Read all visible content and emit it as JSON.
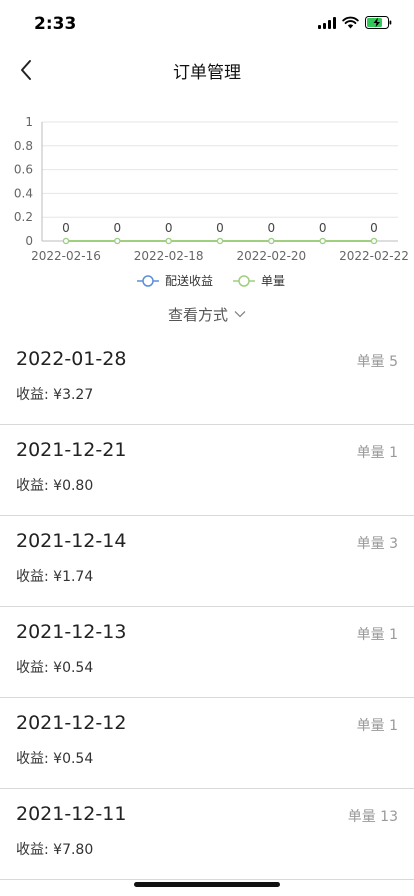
{
  "status": {
    "time": "2:33"
  },
  "nav": {
    "title": "订单管理"
  },
  "chart_data": {
    "type": "line",
    "x": [
      "2022-02-16",
      "2022-02-17",
      "2022-02-18",
      "2022-02-19",
      "2022-02-20",
      "2022-02-21",
      "2022-02-22"
    ],
    "x_tick_labels": [
      "2022-02-16",
      "2022-02-18",
      "2022-02-20",
      "2022-02-22"
    ],
    "ylim": [
      0,
      1
    ],
    "y_ticks": [
      "0",
      "0.2",
      "0.4",
      "0.6",
      "0.8",
      "1"
    ],
    "series": [
      {
        "name": "配送收益",
        "values": [
          0,
          0,
          0,
          0,
          0,
          0,
          0
        ],
        "color": "#5b8fd9"
      },
      {
        "name": "单量",
        "values": [
          0,
          0,
          0,
          0,
          0,
          0,
          0
        ],
        "color": "#9fcf7f"
      }
    ],
    "data_labels": [
      "0",
      "0",
      "0",
      "0",
      "0",
      "0",
      "0"
    ],
    "legend_position": "bottom",
    "grid": true
  },
  "view_mode": {
    "label": "查看方式"
  },
  "orders": [
    {
      "date": "2022-01-28",
      "count_label": "单量 5",
      "earn_label": "收益: ¥3.27"
    },
    {
      "date": "2021-12-21",
      "count_label": "单量 1",
      "earn_label": "收益: ¥0.80"
    },
    {
      "date": "2021-12-14",
      "count_label": "单量 3",
      "earn_label": "收益: ¥1.74"
    },
    {
      "date": "2021-12-13",
      "count_label": "单量 1",
      "earn_label": "收益: ¥0.54"
    },
    {
      "date": "2021-12-12",
      "count_label": "单量 1",
      "earn_label": "收益: ¥0.54"
    },
    {
      "date": "2021-12-11",
      "count_label": "单量 13",
      "earn_label": "收益: ¥7.80"
    }
  ]
}
